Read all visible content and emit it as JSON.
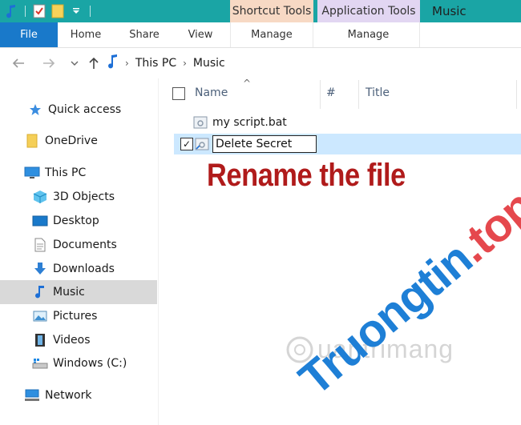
{
  "titlebar": {
    "contextual_tabs": {
      "shortcut_tools": "Shortcut Tools",
      "application_tools": "Application Tools"
    },
    "window_title": "Music",
    "colors": {
      "bar": "#1aa5a5",
      "shortcut_bg": "#f7d9c4",
      "application_bg": "#e2d6f2"
    }
  },
  "ribbon": {
    "tabs": [
      "File",
      "Home",
      "Share",
      "View"
    ],
    "manage_shortcut": "Manage",
    "manage_application": "Manage",
    "file_tab_color": "#1979ca"
  },
  "address": {
    "breadcrumbs": [
      "This PC",
      "Music"
    ],
    "icons": [
      "back-arrow-icon",
      "forward-arrow-icon",
      "recent-locations-chevron-icon",
      "up-arrow-icon",
      "music-folder-icon"
    ]
  },
  "navpane": {
    "items": [
      {
        "label": "Quick access",
        "icon": "star-icon"
      },
      {
        "label": "OneDrive",
        "icon": "folder-icon"
      },
      {
        "label": "This PC",
        "icon": "monitor-icon"
      },
      {
        "label": "3D Objects",
        "icon": "cube-icon"
      },
      {
        "label": "Desktop",
        "icon": "desktop-icon"
      },
      {
        "label": "Documents",
        "icon": "document-icon"
      },
      {
        "label": "Downloads",
        "icon": "download-icon"
      },
      {
        "label": "Music",
        "icon": "music-note-icon"
      },
      {
        "label": "Pictures",
        "icon": "pictures-icon"
      },
      {
        "label": "Videos",
        "icon": "film-icon"
      },
      {
        "label": "Windows (C:)",
        "icon": "drive-icon"
      },
      {
        "label": "Network",
        "icon": "network-icon"
      }
    ],
    "selected": "Music"
  },
  "columns": {
    "name": "Name",
    "number": "#",
    "title": "Title"
  },
  "files": [
    {
      "name": "my script.bat",
      "checked": false
    },
    {
      "name": "Delete Secret",
      "checked": true,
      "renaming": true
    }
  ],
  "annotation": "Rename the file",
  "watermarks": {
    "quantrimang": "uantrimang",
    "truongtin_a": "Truongtin",
    "truongtin_b": ".top"
  }
}
